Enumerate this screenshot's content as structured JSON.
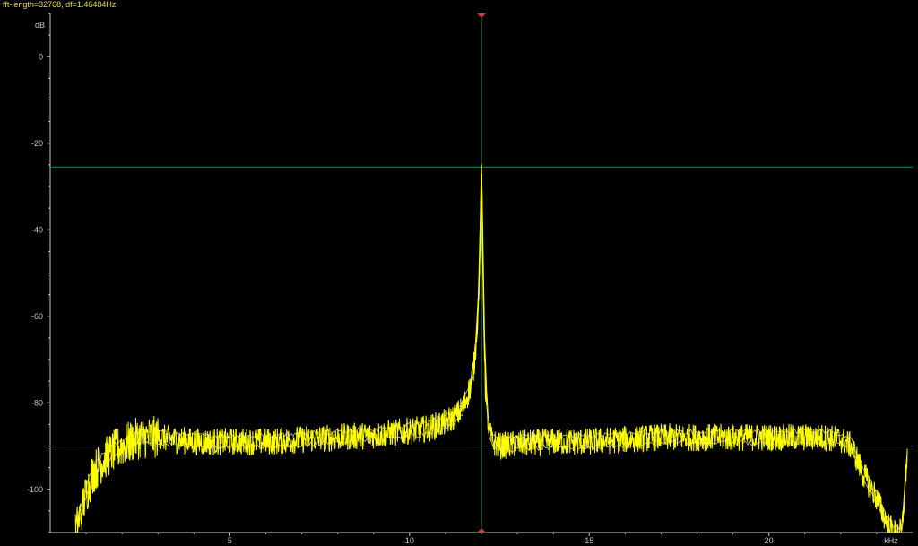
{
  "header": {
    "info": "fft-length=32768, df=1.46484Hz"
  },
  "colors": {
    "background": "#000000",
    "trace": "#ffff00",
    "trace_outline": "#e0e0e0",
    "axis": "#c8c8c8",
    "marker_vertical": "#2e8b57",
    "marker_horizontal_upper": "#2e8b3a",
    "marker_horizontal_lower": "#b01818"
  },
  "chart_data": {
    "type": "line",
    "title": "",
    "xlabel": "kHz",
    "ylabel": "dB",
    "xlim": [
      0,
      24
    ],
    "ylim": [
      -110,
      10
    ],
    "x_ticks": [
      5,
      10,
      15,
      20
    ],
    "y_ticks": [
      0,
      -20,
      -40,
      -60,
      -80,
      -100
    ],
    "grid": false,
    "legend": "none",
    "markers": {
      "vertical_x": 12.0,
      "horizontal_upper_y": -25.5,
      "horizontal_lower_y": -90.0
    },
    "series": [
      {
        "x": [
          0.7,
          0.9,
          1.0,
          1.2,
          1.5,
          1.8,
          2.0,
          2.5,
          3.0,
          4.0,
          5.0,
          6.0,
          7.0,
          8.0,
          9.0,
          10.0,
          10.5,
          11.0,
          11.3,
          11.5,
          11.7,
          11.8,
          11.9,
          11.95,
          12.0,
          12.05,
          12.1,
          12.2,
          12.3,
          12.5,
          13.0,
          14.0,
          15.0,
          16.0,
          17.0,
          18.0,
          19.0,
          20.0,
          21.0,
          21.5,
          22.0,
          22.3,
          22.6,
          23.0,
          23.3,
          23.5,
          23.7,
          23.85
        ],
        "y": [
          -110,
          -104,
          -101,
          -96,
          -93,
          -91,
          -90,
          -88,
          -88,
          -89,
          -89,
          -89,
          -88.5,
          -88,
          -87.5,
          -86.5,
          -86,
          -84.5,
          -83,
          -81,
          -76,
          -71,
          -60,
          -48,
          -27,
          -50,
          -75,
          -86,
          -89,
          -90,
          -89.5,
          -89,
          -89,
          -88.5,
          -88,
          -88,
          -88,
          -88,
          -88,
          -88,
          -88.5,
          -90,
          -96,
          -102,
          -108,
          -110,
          -110,
          -92
        ]
      }
    ]
  }
}
